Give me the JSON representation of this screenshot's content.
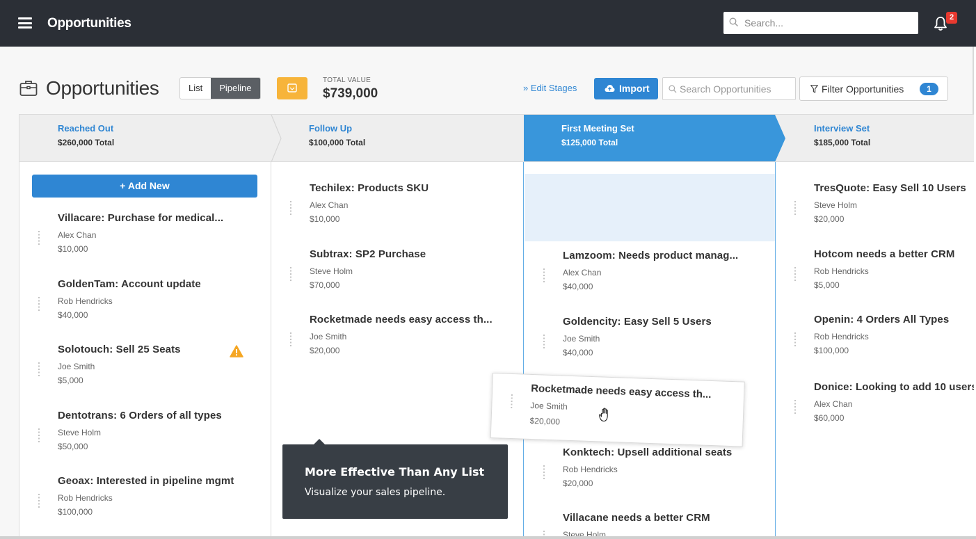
{
  "app": {
    "title": "Opportunities",
    "search_placeholder": "Search...",
    "notification_count": "2"
  },
  "toolbar": {
    "title": "Opportunities",
    "views": [
      "List",
      "Pipeline"
    ],
    "active_view": "Pipeline",
    "total_label": "TOTAL VALUE",
    "total_value": "$739,000",
    "edit_stages": "» Edit Stages",
    "import_label": "Import",
    "search_placeholder": "Search Opportunities",
    "filter_label": "Filter Opportunities",
    "filter_count": "1"
  },
  "colors": {
    "accent": "#2f86d3",
    "topbar": "#2b2f36",
    "calendar_button": "#f7b43a",
    "warning": "#f5a623",
    "tooltip": "#383e45",
    "drop_zone": "#e6f0fa"
  },
  "stages": [
    {
      "name": "Reached Out",
      "total": "$260,000 Total"
    },
    {
      "name": "Follow Up",
      "total": "$100,000 Total"
    },
    {
      "name": "First Meeting Set",
      "total": "$125,000 Total",
      "active": true
    },
    {
      "name": "Interview Set",
      "total": "$185,000 Total"
    }
  ],
  "columns": {
    "reached_out": {
      "add_new": "+ Add New",
      "cards": [
        {
          "title": "Villacare: Purchase for medical...",
          "owner": "Alex Chan",
          "amount": "$10,000"
        },
        {
          "title": "GoldenTam: Account update",
          "owner": "Rob Hendricks",
          "amount": "$40,000"
        },
        {
          "title": "Solotouch: Sell 25 Seats",
          "owner": "Joe Smith",
          "amount": "$5,000",
          "warning": true
        },
        {
          "title": "Dentotrans: 6 Orders of all types",
          "owner": "Steve Holm",
          "amount": "$50,000"
        },
        {
          "title": "Geoax: Interested in pipeline mgmt",
          "owner": "Rob Hendricks",
          "amount": "$100,000"
        }
      ]
    },
    "follow_up": {
      "cards": [
        {
          "title": "Techilex: Products SKU",
          "owner": "Alex Chan",
          "amount": "$10,000"
        },
        {
          "title": "Subtrax: SP2 Purchase",
          "owner": "Steve Holm",
          "amount": "$70,000"
        },
        {
          "title": "Rocketmade needs easy access th...",
          "owner": "Joe Smith",
          "amount": "$20,000"
        }
      ]
    },
    "first_meeting_set": {
      "cards": [
        {
          "title": "Lamzoom: Needs product manag...",
          "owner": "Alex Chan",
          "amount": "$40,000"
        },
        {
          "title": "Goldencity: Easy Sell 5 Users",
          "owner": "Joe Smith",
          "amount": "$40,000"
        },
        {
          "title": "Konktech: Upsell additional seats",
          "owner": "Rob Hendricks",
          "amount": "$20,000"
        },
        {
          "title": "Villacane needs a better CRM",
          "owner": "Steve Holm",
          "amount": ""
        }
      ]
    },
    "interview_set": {
      "cards": [
        {
          "title": "TresQuote: Easy Sell 10 Users",
          "owner": "Steve Holm",
          "amount": "$20,000"
        },
        {
          "title": "Hotcom needs a better CRM",
          "owner": "Rob Hendricks",
          "amount": "$5,000"
        },
        {
          "title": "Openin: 4 Orders All Types",
          "owner": "Rob Hendricks",
          "amount": "$100,000"
        },
        {
          "title": "Donice: Looking to add 10 users",
          "owner": "Alex Chan",
          "amount": "$60,000"
        }
      ]
    }
  },
  "dragging_card": {
    "title": "Rocketmade needs easy access th...",
    "owner": "Joe Smith",
    "amount": "$20,000"
  },
  "tooltip": {
    "title": "More Effective Than Any List",
    "body": "Visualize your sales pipeline."
  }
}
